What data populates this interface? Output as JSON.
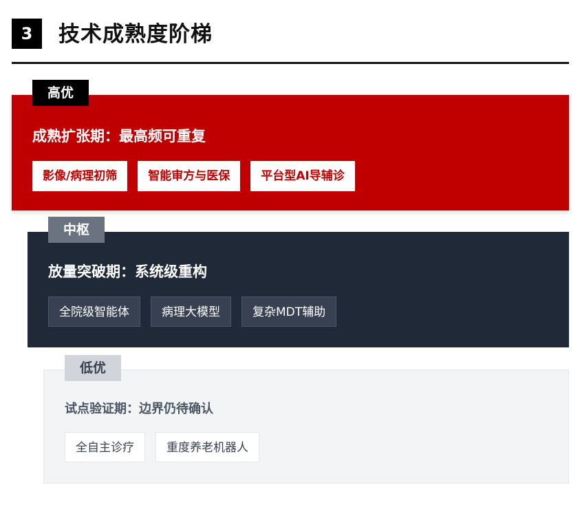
{
  "section": {
    "number": "3",
    "title": "技术成熟度阶梯"
  },
  "tiers": [
    {
      "label": "高优",
      "heading": "成熟扩张期：最高频可重复",
      "tags": [
        "影像/病理初筛",
        "智能审方与医保",
        "平台型AI导辅诊"
      ]
    },
    {
      "label": "中枢",
      "heading": "放量突破期：系统级重构",
      "tags": [
        "全院级智能体",
        "病理大模型",
        "复杂MDT辅助"
      ]
    },
    {
      "label": "低优",
      "heading": "试点验证期：边界仍待确认",
      "tags": [
        "全自主诊疗",
        "重度养老机器人"
      ]
    }
  ],
  "colors": {
    "high": "#c00000",
    "mid": "#1f2937",
    "low": "#f3f4f6"
  }
}
